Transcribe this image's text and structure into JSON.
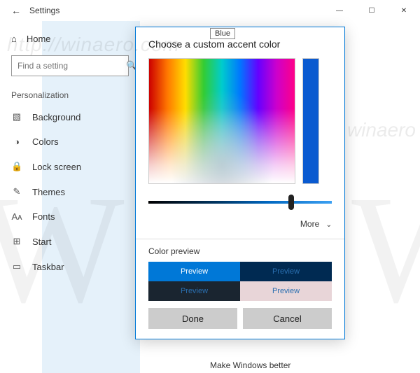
{
  "titlebar": {
    "app_name": "Settings",
    "back_glyph": "←",
    "min_glyph": "—",
    "max_glyph": "☐",
    "close_glyph": "✕"
  },
  "sidebar": {
    "home_label": "Home",
    "home_glyph": "⌂",
    "search_placeholder": "Find a setting",
    "search_glyph": "🔍",
    "group_title": "Personalization",
    "items": [
      {
        "glyph": "▧",
        "label": "Background"
      },
      {
        "glyph": "◑",
        "label": "Colors"
      },
      {
        "glyph": "🔒",
        "label": "Lock screen"
      },
      {
        "glyph": "✎",
        "label": "Themes"
      },
      {
        "glyph": "Aᴀ",
        "label": "Fonts"
      },
      {
        "glyph": "⊞",
        "label": "Start"
      },
      {
        "glyph": "▭",
        "label": "Taskbar"
      }
    ]
  },
  "dialog": {
    "title": "Choose a custom accent color",
    "more_label": "More",
    "more_glyph": "⌄",
    "preview_label": "Color preview",
    "preview_tiles": {
      "t1": "Preview",
      "t2": "Preview",
      "t3": "Preview",
      "t4": "Preview"
    },
    "done_label": "Done",
    "cancel_label": "Cancel"
  },
  "tooltip": {
    "text": "Blue"
  },
  "footer": {
    "text": "Make Windows better"
  },
  "watermark": {
    "text1": "http://winaero.com",
    "text2": "winaero"
  }
}
